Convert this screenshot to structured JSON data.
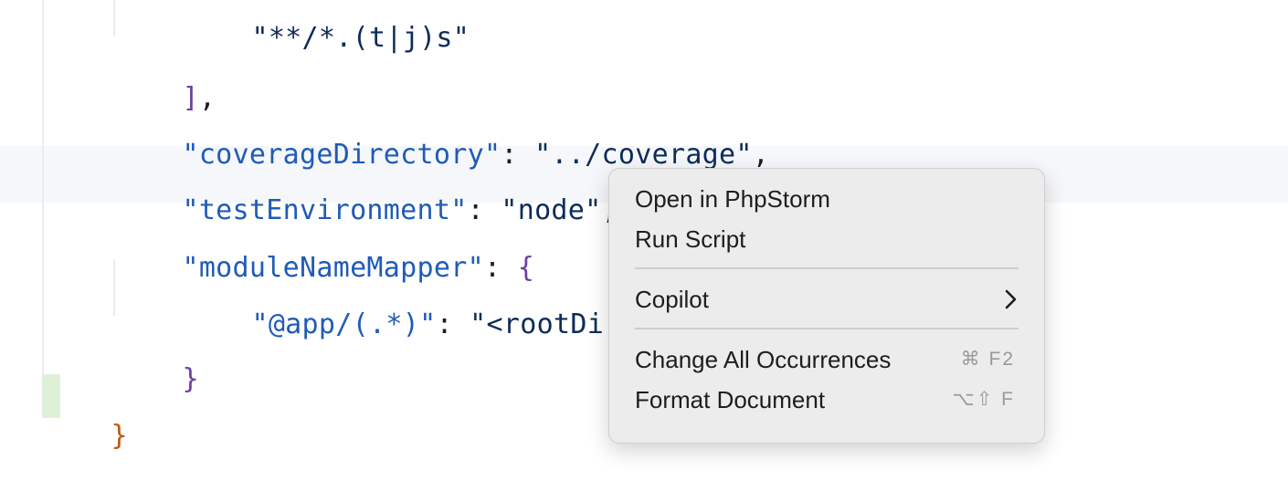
{
  "editor": {
    "lines": {
      "l0": {
        "text": "\"**/*.(t|j)s\""
      },
      "l1": {
        "bracket": "]",
        "comma": ","
      },
      "l2": {
        "key": "\"coverageDirectory\"",
        "colon": ": ",
        "value": "\"../coverage\"",
        "comma": ","
      },
      "l3": {
        "key": "\"testEnvironment\"",
        "colon": ": ",
        "value": "\"node\"",
        "comma": ","
      },
      "l4": {
        "key": "\"moduleNameMapper\"",
        "colon": ": ",
        "brace": "{"
      },
      "l5": {
        "key": "\"@app/(.*)\"",
        "colon": ": ",
        "value": "\"<rootDir>/"
      },
      "l6": {
        "brace": "}"
      },
      "l7": {
        "brace": "}"
      }
    }
  },
  "context_menu": {
    "items": [
      {
        "label": "Open in PhpStorm"
      },
      {
        "label": "Run Script"
      },
      {
        "label": "Copilot",
        "icon": "chevron-right-icon"
      },
      {
        "label": "Change All Occurrences",
        "shortcut": "⌘ F2"
      },
      {
        "label": "Format Document",
        "shortcut": "⌥⇧ F"
      }
    ]
  },
  "colors": {
    "json_key": "#1f5bb8",
    "json_string": "#0c2c5a",
    "bracket": "#6b3fa0",
    "root_brace": "#c15a12",
    "menu_bg": "#ececec",
    "highlight_row": "#f5f7fa"
  }
}
